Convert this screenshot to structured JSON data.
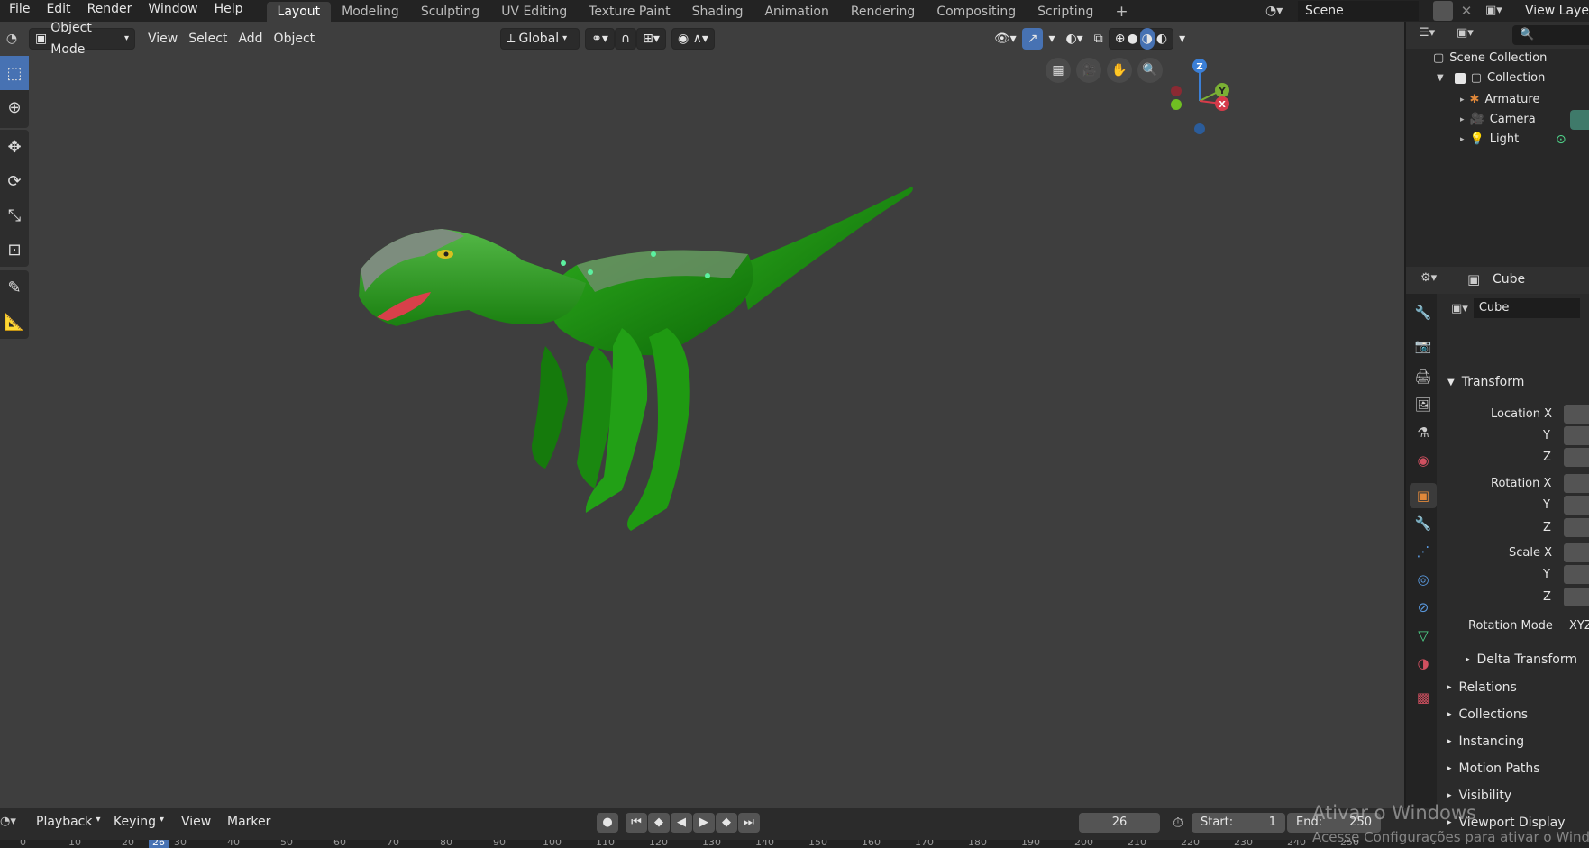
{
  "topbar": {
    "menus": [
      "File",
      "Edit",
      "Render",
      "Window",
      "Help"
    ],
    "workspace_tabs": [
      "Layout",
      "Modeling",
      "Sculpting",
      "UV Editing",
      "Texture Paint",
      "Shading",
      "Animation",
      "Rendering",
      "Compositing",
      "Scripting"
    ],
    "active_tab": "Layout",
    "add_tab_icon": "plus-icon",
    "scene_name": "Scene",
    "view_layer": "View Layer"
  },
  "viewport_header": {
    "mode": "Object Mode",
    "menus": [
      "View",
      "Select",
      "Add",
      "Object"
    ],
    "transform_orientation": "Global"
  },
  "outliner": {
    "root": "Scene Collection",
    "collection": "Collection",
    "items": [
      "Armature",
      "Camera",
      "Light"
    ]
  },
  "properties": {
    "object_name": "Cube",
    "data_name": "Cube",
    "transform_header": "Transform",
    "location_x": "Location X",
    "rotation_x": "Rotation X",
    "scale_x": "Scale X",
    "axis_y": "Y",
    "axis_z": "Z",
    "rotation_mode_label": "Rotation Mode",
    "rotation_mode_value": "XYZ",
    "delta_transform": "Delta Transform",
    "panels": [
      "Relations",
      "Collections",
      "Instancing",
      "Motion Paths",
      "Visibility",
      "Viewport Display"
    ]
  },
  "gizmo": {
    "z": "Z",
    "y": "Y",
    "x": "X"
  },
  "timeline": {
    "menus": [
      "Playback",
      "Keying",
      "View",
      "Marker"
    ],
    "current_frame": "26",
    "start_label": "Start:",
    "start_value": "1",
    "end_label": "End:",
    "end_value": "250",
    "ruler": [
      "0",
      "10",
      "20",
      "26",
      "30",
      "40",
      "50",
      "60",
      "70",
      "80",
      "90",
      "100",
      "110",
      "120",
      "130",
      "140",
      "150",
      "160",
      "170",
      "180",
      "190",
      "200",
      "210",
      "220",
      "230",
      "240",
      "250"
    ]
  },
  "watermark": {
    "line1": "Ativar o Windows",
    "line2": "Acesse Configurações para ativar o Windows."
  },
  "colors": {
    "accent": "#4772b3",
    "dino_green": "#1f9a12",
    "viewport_bg": "#3e3e3e"
  }
}
